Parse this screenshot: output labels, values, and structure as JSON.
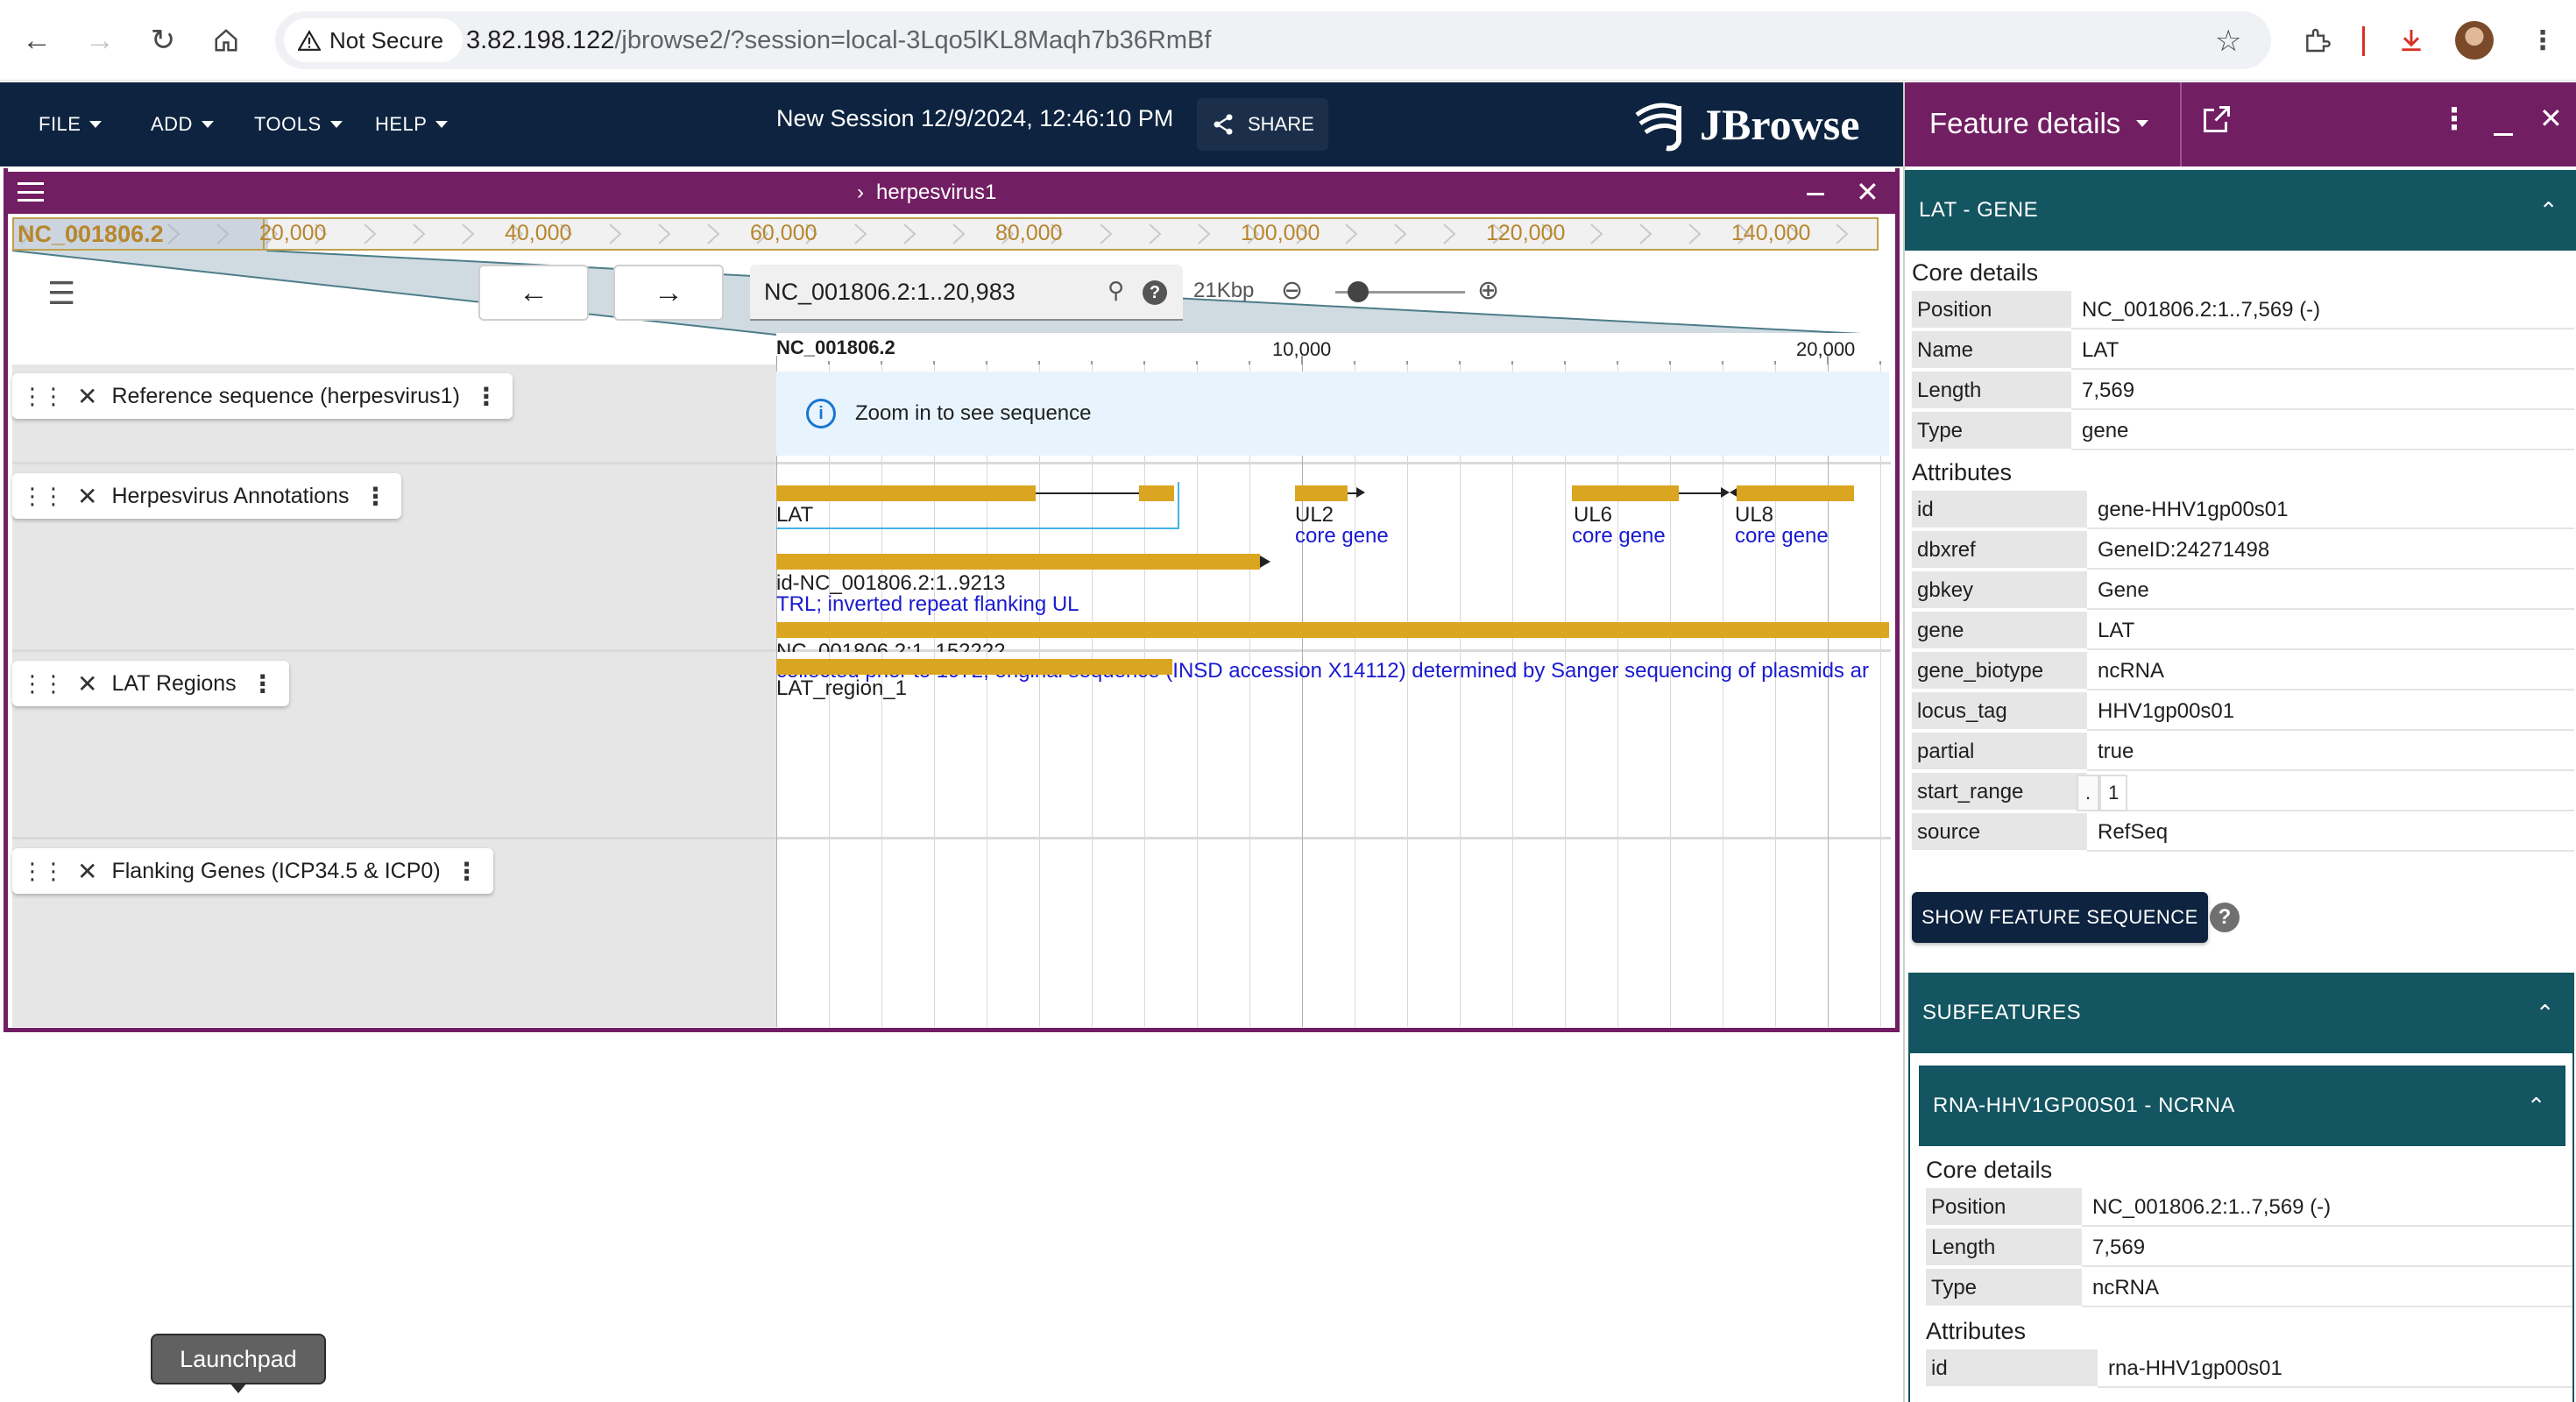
{
  "browser": {
    "not_secure_label": "Not Secure",
    "url_host": "3.82.198.122",
    "url_path": "/jbrowse2/?session=local-3Lqo5lKL8Maqh7b36RmBf"
  },
  "app_bar": {
    "menus": [
      "FILE",
      "ADD",
      "TOOLS",
      "HELP"
    ],
    "session_title": "New Session 12/9/2024, 12:46:10 PM",
    "share_label": "SHARE",
    "logo_text": "JBrowse"
  },
  "view": {
    "assembly_name": "herpesvirus1",
    "overview": {
      "ref_name": "NC_001806.2",
      "ticks": [
        "20,000",
        "40,000",
        "60,000",
        "80,000",
        "100,000",
        "120,000",
        "140,000"
      ]
    },
    "location": "NC_001806.2:1..20,983",
    "bp_per_view": "21Kbp",
    "zoom_level": 0.15,
    "ruler": {
      "ref_name": "NC_001806.2",
      "ticks": [
        "10,000",
        "20,000"
      ]
    },
    "zoom_message": "Zoom in to see sequence",
    "tracks": [
      {
        "name": "Reference sequence (herpesvirus1)"
      },
      {
        "name": "Herpesvirus Annotations"
      },
      {
        "name": "LAT Regions"
      },
      {
        "name": "Flanking Genes (ICP34.5 & ICP0)"
      }
    ],
    "features": {
      "lat_label": "LAT",
      "ul2_label": "UL2",
      "ul2_desc": "core gene",
      "ul6_label": "UL6",
      "ul6_desc": "core gene",
      "ul8_label": "UL8",
      "ul8_desc": "core gene",
      "trl_label": "id-NC_001806.2:1..9213",
      "trl_desc": "TRL; inverted repeat flanking UL",
      "source_label": "NC_001806.2:1..152222",
      "source_desc": "collected prior to 1972; original sequence (INSD accession X14112) determined by Sanger sequencing of plasmids ar",
      "lat_region_label": "LAT_region_1"
    }
  },
  "drawer": {
    "title": "Feature details",
    "gene_section": "LAT - GENE",
    "core_details_title": "Core details",
    "core": [
      {
        "k": "Position",
        "v": "NC_001806.2:1..7,569 (-)"
      },
      {
        "k": "Name",
        "v": "LAT"
      },
      {
        "k": "Length",
        "v": "7,569"
      },
      {
        "k": "Type",
        "v": "gene"
      }
    ],
    "attributes_title": "Attributes",
    "attributes": [
      {
        "k": "id",
        "v": "gene-HHV1gp00s01"
      },
      {
        "k": "dbxref",
        "v": "GeneID:24271498"
      },
      {
        "k": "gbkey",
        "v": "Gene"
      },
      {
        "k": "gene",
        "v": "LAT"
      },
      {
        "k": "gene_biotype",
        "v": "ncRNA"
      },
      {
        "k": "locus_tag",
        "v": "HHV1gp00s01"
      },
      {
        "k": "partial",
        "v": "true"
      },
      {
        "k": "start_range",
        "v": ""
      },
      {
        "k": "source",
        "v": "RefSeq"
      }
    ],
    "start_range_values": [
      ".",
      "1"
    ],
    "show_sequence_label": "SHOW FEATURE SEQUENCE",
    "subfeatures_title": "SUBFEATURES",
    "rna_section": "RNA-HHV1GP00S01 - NCRNA",
    "rna_core_title": "Core details",
    "rna_core": [
      {
        "k": "Position",
        "v": "NC_001806.2:1..7,569 (-)"
      },
      {
        "k": "Length",
        "v": "7,569"
      },
      {
        "k": "Type",
        "v": "ncRNA"
      }
    ],
    "rna_attributes_title": "Attributes",
    "rna_attributes": [
      {
        "k": "id",
        "v": "rna-HHV1gp00s01"
      }
    ]
  },
  "launchpad_tooltip": "Launchpad"
}
